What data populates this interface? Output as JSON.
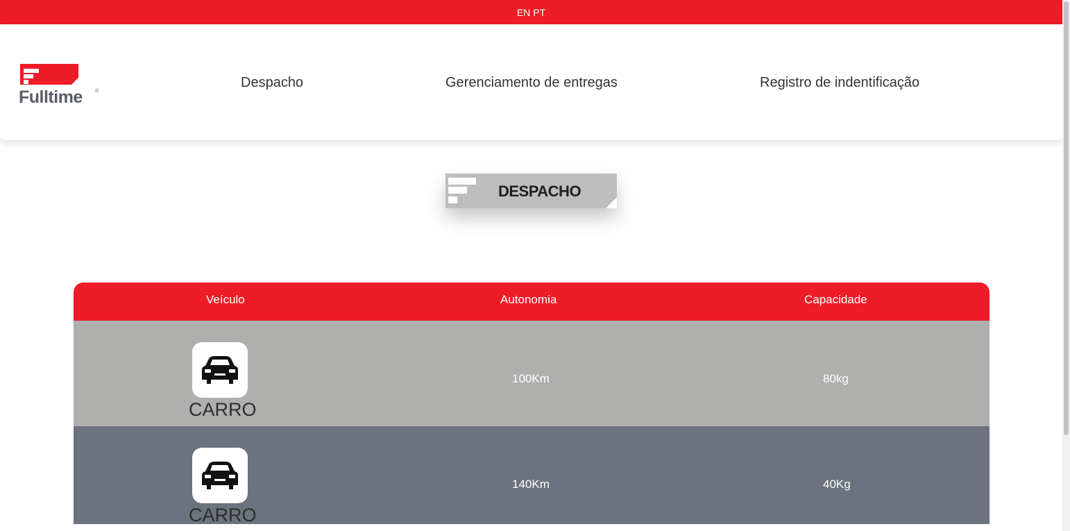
{
  "lang": {
    "en": "EN",
    "pt": "PT"
  },
  "brand": {
    "name": "Fulltime",
    "reg": "®",
    "color": "#ee1c27"
  },
  "nav": [
    {
      "label": "Despacho"
    },
    {
      "label": "Gerenciamento de entregas"
    },
    {
      "label": "Registro de indentificação"
    }
  ],
  "section": {
    "title": "DESPACHO"
  },
  "table": {
    "headers": [
      "Veículo",
      "Autonomia",
      "Capacidade"
    ],
    "rows": [
      {
        "vehicle": "CARRO",
        "icon": "car-icon",
        "autonomy": "100Km",
        "capacity": "80kg",
        "bg": "#afafad"
      },
      {
        "vehicle": "CARRO",
        "icon": "car-icon",
        "autonomy": "140Km",
        "capacity": "40Kg",
        "bg": "#6c737e"
      }
    ]
  }
}
